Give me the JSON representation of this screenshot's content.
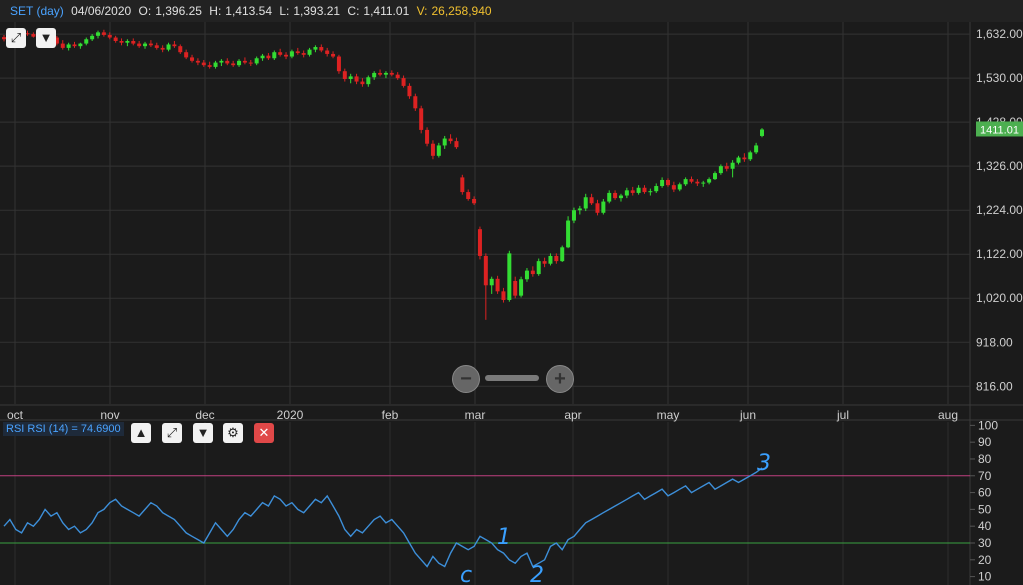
{
  "header": {
    "symbol": "SET (day)",
    "date": "04/06/2020",
    "o_label": "O:",
    "o_value": "1,396.25",
    "h_label": "H:",
    "h_value": "1,413.54",
    "l_label": "L:",
    "l_value": "1,393.21",
    "c_label": "C:",
    "c_value": "1,411.01",
    "v_label": "V:",
    "v_value": "26,258,940"
  },
  "colors": {
    "up": "#33dd33",
    "down": "#dd2222",
    "rsi_line": "#3d8fd9",
    "last_price_bg": "#4caf50",
    "overbought": "#c04080",
    "oversold": "#3aa040"
  },
  "icons": [
    "expand-icon",
    "arrow-down-icon",
    "arrow-up-icon",
    "gear-icon",
    "close-icon",
    "zoom-out-icon",
    "zoom-in-icon"
  ],
  "last_price_tag": "1411.01",
  "rsi_legend": "RSI RSI (14) = 74.6900",
  "chart_data": [
    {
      "type": "candlestick",
      "symbol": "SET",
      "ylim": [
        775,
        1660
      ],
      "y_ticks": [
        "1,632.00",
        "1,530.00",
        "1,428.00",
        "1,326.00",
        "1,224.00",
        "1,122.00",
        "1,020.00",
        "918.00",
        "816.00"
      ],
      "x_ticks": [
        "oct",
        "nov",
        "dec",
        "2020",
        "feb",
        "mar",
        "apr",
        "may",
        "jun",
        "jul",
        "aug"
      ],
      "last_close": 1411.01,
      "candles": [
        [
          1,
          1625,
          1630,
          1615,
          1620
        ],
        [
          2,
          1620,
          1628,
          1614,
          1626
        ],
        [
          3,
          1626,
          1635,
          1620,
          1630
        ],
        [
          4,
          1630,
          1638,
          1625,
          1634
        ],
        [
          5,
          1634,
          1640,
          1628,
          1632
        ],
        [
          6,
          1632,
          1636,
          1624,
          1626
        ],
        [
          7,
          1626,
          1632,
          1618,
          1622
        ],
        [
          8,
          1622,
          1630,
          1616,
          1628
        ],
        [
          9,
          1628,
          1634,
          1620,
          1624
        ],
        [
          10,
          1624,
          1628,
          1606,
          1610
        ],
        [
          11,
          1610,
          1618,
          1596,
          1600
        ],
        [
          12,
          1600,
          1612,
          1594,
          1608
        ],
        [
          13,
          1608,
          1614,
          1600,
          1604
        ],
        [
          14,
          1604,
          1612,
          1598,
          1610
        ],
        [
          15,
          1610,
          1624,
          1606,
          1620
        ],
        [
          16,
          1620,
          1632,
          1616,
          1628
        ],
        [
          17,
          1628,
          1640,
          1622,
          1636
        ],
        [
          18,
          1636,
          1642,
          1626,
          1630
        ],
        [
          19,
          1630,
          1636,
          1620,
          1624
        ],
        [
          20,
          1624,
          1628,
          1612,
          1616
        ],
        [
          21,
          1616,
          1622,
          1606,
          1612
        ],
        [
          22,
          1612,
          1620,
          1604,
          1616
        ],
        [
          23,
          1616,
          1622,
          1606,
          1610
        ],
        [
          24,
          1610,
          1616,
          1600,
          1604
        ],
        [
          25,
          1604,
          1614,
          1598,
          1610
        ],
        [
          26,
          1610,
          1618,
          1602,
          1606
        ],
        [
          27,
          1606,
          1612,
          1596,
          1600
        ],
        [
          28,
          1600,
          1606,
          1590,
          1596
        ],
        [
          29,
          1596,
          1612,
          1592,
          1608
        ],
        [
          30,
          1608,
          1616,
          1600,
          1604
        ],
        [
          31,
          1604,
          1608,
          1586,
          1590
        ],
        [
          32,
          1590,
          1596,
          1574,
          1578
        ],
        [
          33,
          1578,
          1584,
          1566,
          1570
        ],
        [
          34,
          1570,
          1576,
          1560,
          1566
        ],
        [
          35,
          1566,
          1572,
          1556,
          1560
        ],
        [
          36,
          1560,
          1568,
          1552,
          1556
        ],
        [
          37,
          1556,
          1570,
          1552,
          1566
        ],
        [
          38,
          1566,
          1574,
          1558,
          1570
        ],
        [
          39,
          1570,
          1576,
          1560,
          1564
        ],
        [
          40,
          1564,
          1570,
          1556,
          1560
        ],
        [
          41,
          1560,
          1574,
          1556,
          1570
        ],
        [
          42,
          1570,
          1578,
          1562,
          1566
        ],
        [
          43,
          1566,
          1572,
          1558,
          1564
        ],
        [
          44,
          1564,
          1580,
          1560,
          1576
        ],
        [
          45,
          1576,
          1586,
          1570,
          1582
        ],
        [
          46,
          1582,
          1588,
          1572,
          1576
        ],
        [
          47,
          1576,
          1594,
          1572,
          1590
        ],
        [
          48,
          1590,
          1598,
          1580,
          1584
        ],
        [
          49,
          1584,
          1590,
          1574,
          1580
        ],
        [
          50,
          1580,
          1596,
          1576,
          1592
        ],
        [
          51,
          1592,
          1600,
          1584,
          1588
        ],
        [
          52,
          1588,
          1594,
          1578,
          1584
        ],
        [
          53,
          1584,
          1600,
          1580,
          1596
        ],
        [
          54,
          1596,
          1606,
          1590,
          1602
        ],
        [
          55,
          1602,
          1608,
          1590,
          1594
        ],
        [
          56,
          1594,
          1600,
          1580,
          1586
        ],
        [
          57,
          1586,
          1592,
          1576,
          1580
        ],
        [
          58,
          1580,
          1584,
          1540,
          1546
        ],
        [
          59,
          1546,
          1552,
          1522,
          1528
        ],
        [
          60,
          1528,
          1540,
          1518,
          1534
        ],
        [
          61,
          1534,
          1540,
          1516,
          1522
        ],
        [
          62,
          1522,
          1530,
          1510,
          1516
        ],
        [
          63,
          1516,
          1536,
          1510,
          1532
        ],
        [
          64,
          1532,
          1546,
          1526,
          1542
        ],
        [
          65,
          1542,
          1550,
          1534,
          1538
        ],
        [
          66,
          1538,
          1546,
          1530,
          1542
        ],
        [
          67,
          1542,
          1548,
          1534,
          1538
        ],
        [
          68,
          1538,
          1544,
          1526,
          1530
        ],
        [
          69,
          1530,
          1536,
          1508,
          1512
        ],
        [
          70,
          1512,
          1518,
          1482,
          1488
        ],
        [
          71,
          1488,
          1494,
          1454,
          1460
        ],
        [
          72,
          1460,
          1466,
          1402,
          1410
        ],
        [
          73,
          1410,
          1416,
          1372,
          1378
        ],
        [
          74,
          1378,
          1386,
          1342,
          1350
        ],
        [
          75,
          1350,
          1380,
          1346,
          1374
        ],
        [
          76,
          1374,
          1396,
          1366,
          1390
        ],
        [
          77,
          1390,
          1400,
          1378,
          1384
        ],
        [
          78,
          1384,
          1392,
          1366,
          1370
        ],
        [
          79,
          1300,
          1306,
          1260,
          1266
        ],
        [
          80,
          1266,
          1272,
          1246,
          1250
        ],
        [
          81,
          1250,
          1256,
          1236,
          1240
        ],
        [
          82,
          1180,
          1186,
          1110,
          1118
        ],
        [
          83,
          1118,
          1124,
          970,
          1050
        ],
        [
          84,
          1050,
          1070,
          1030,
          1065
        ],
        [
          85,
          1065,
          1072,
          1030,
          1036
        ],
        [
          86,
          1036,
          1044,
          1010,
          1016
        ],
        [
          87,
          1016,
          1130,
          1012,
          1124
        ],
        [
          88,
          1060,
          1070,
          1020,
          1026
        ],
        [
          89,
          1026,
          1070,
          1022,
          1064
        ],
        [
          90,
          1064,
          1090,
          1058,
          1084
        ],
        [
          91,
          1084,
          1094,
          1070,
          1076
        ],
        [
          92,
          1076,
          1112,
          1072,
          1106
        ],
        [
          93,
          1106,
          1114,
          1092,
          1100
        ],
        [
          94,
          1100,
          1124,
          1096,
          1118
        ],
        [
          95,
          1118,
          1124,
          1100,
          1106
        ],
        [
          96,
          1106,
          1142,
          1104,
          1138
        ],
        [
          97,
          1138,
          1210,
          1136,
          1200
        ],
        [
          98,
          1200,
          1230,
          1194,
          1224
        ],
        [
          99,
          1224,
          1234,
          1214,
          1228
        ],
        [
          100,
          1228,
          1262,
          1222,
          1254
        ],
        [
          101,
          1254,
          1262,
          1236,
          1240
        ],
        [
          102,
          1240,
          1248,
          1212,
          1218
        ],
        [
          103,
          1218,
          1250,
          1214,
          1244
        ],
        [
          104,
          1244,
          1270,
          1240,
          1264
        ],
        [
          105,
          1264,
          1270,
          1248,
          1252
        ],
        [
          106,
          1252,
          1262,
          1244,
          1258
        ],
        [
          107,
          1258,
          1276,
          1252,
          1270
        ],
        [
          108,
          1270,
          1278,
          1258,
          1264
        ],
        [
          109,
          1264,
          1282,
          1260,
          1276
        ],
        [
          110,
          1276,
          1282,
          1262,
          1266
        ],
        [
          111,
          1266,
          1274,
          1258,
          1268
        ],
        [
          112,
          1268,
          1286,
          1264,
          1280
        ],
        [
          113,
          1280,
          1300,
          1276,
          1294
        ],
        [
          114,
          1294,
          1298,
          1278,
          1282
        ],
        [
          115,
          1282,
          1290,
          1266,
          1272
        ],
        [
          116,
          1272,
          1288,
          1268,
          1284
        ],
        [
          117,
          1284,
          1300,
          1280,
          1296
        ],
        [
          118,
          1296,
          1302,
          1286,
          1290
        ],
        [
          119,
          1290,
          1296,
          1280,
          1286
        ],
        [
          120,
          1286,
          1292,
          1278,
          1288
        ],
        [
          121,
          1288,
          1300,
          1284,
          1296
        ],
        [
          122,
          1296,
          1314,
          1294,
          1310
        ],
        [
          123,
          1310,
          1330,
          1306,
          1326
        ],
        [
          124,
          1326,
          1334,
          1314,
          1320
        ],
        [
          125,
          1320,
          1340,
          1300,
          1334
        ],
        [
          126,
          1334,
          1350,
          1330,
          1346
        ],
        [
          127,
          1346,
          1356,
          1336,
          1342
        ],
        [
          128,
          1342,
          1362,
          1338,
          1358
        ],
        [
          129,
          1358,
          1380,
          1354,
          1374
        ],
        [
          130,
          1396,
          1414,
          1393,
          1411
        ]
      ]
    },
    {
      "type": "line",
      "name": "RSI (14)",
      "ylim": [
        5,
        102
      ],
      "y_ticks": [
        "100",
        "90",
        "80",
        "70",
        "60",
        "50",
        "40",
        "30",
        "20",
        "10"
      ],
      "levels": [
        70,
        30
      ],
      "last_value": 74.69,
      "values": [
        40,
        44,
        38,
        36,
        42,
        40,
        44,
        50,
        46,
        48,
        42,
        38,
        40,
        36,
        38,
        42,
        48,
        50,
        54,
        56,
        52,
        50,
        48,
        46,
        50,
        54,
        52,
        48,
        46,
        44,
        40,
        36,
        34,
        32,
        30,
        36,
        42,
        38,
        34,
        38,
        44,
        48,
        46,
        50,
        54,
        52,
        58,
        56,
        52,
        54,
        50,
        48,
        52,
        56,
        54,
        58,
        52,
        46,
        38,
        34,
        38,
        36,
        40,
        44,
        46,
        42,
        44,
        40,
        36,
        30,
        24,
        20,
        16,
        22,
        18,
        16,
        24,
        30,
        28,
        26,
        28,
        34,
        32,
        30,
        26,
        24,
        20,
        18,
        22,
        24,
        16,
        18,
        20,
        28,
        30,
        26,
        32,
        34,
        38,
        42,
        44,
        46,
        48,
        50,
        52,
        54,
        56,
        58,
        60,
        56,
        58,
        60,
        62,
        58,
        60,
        62,
        64,
        60,
        62,
        64,
        66,
        62,
        64,
        66,
        68,
        66,
        68,
        70,
        72,
        74.69
      ],
      "annotations": [
        "1",
        "2",
        "3",
        "c"
      ]
    }
  ]
}
